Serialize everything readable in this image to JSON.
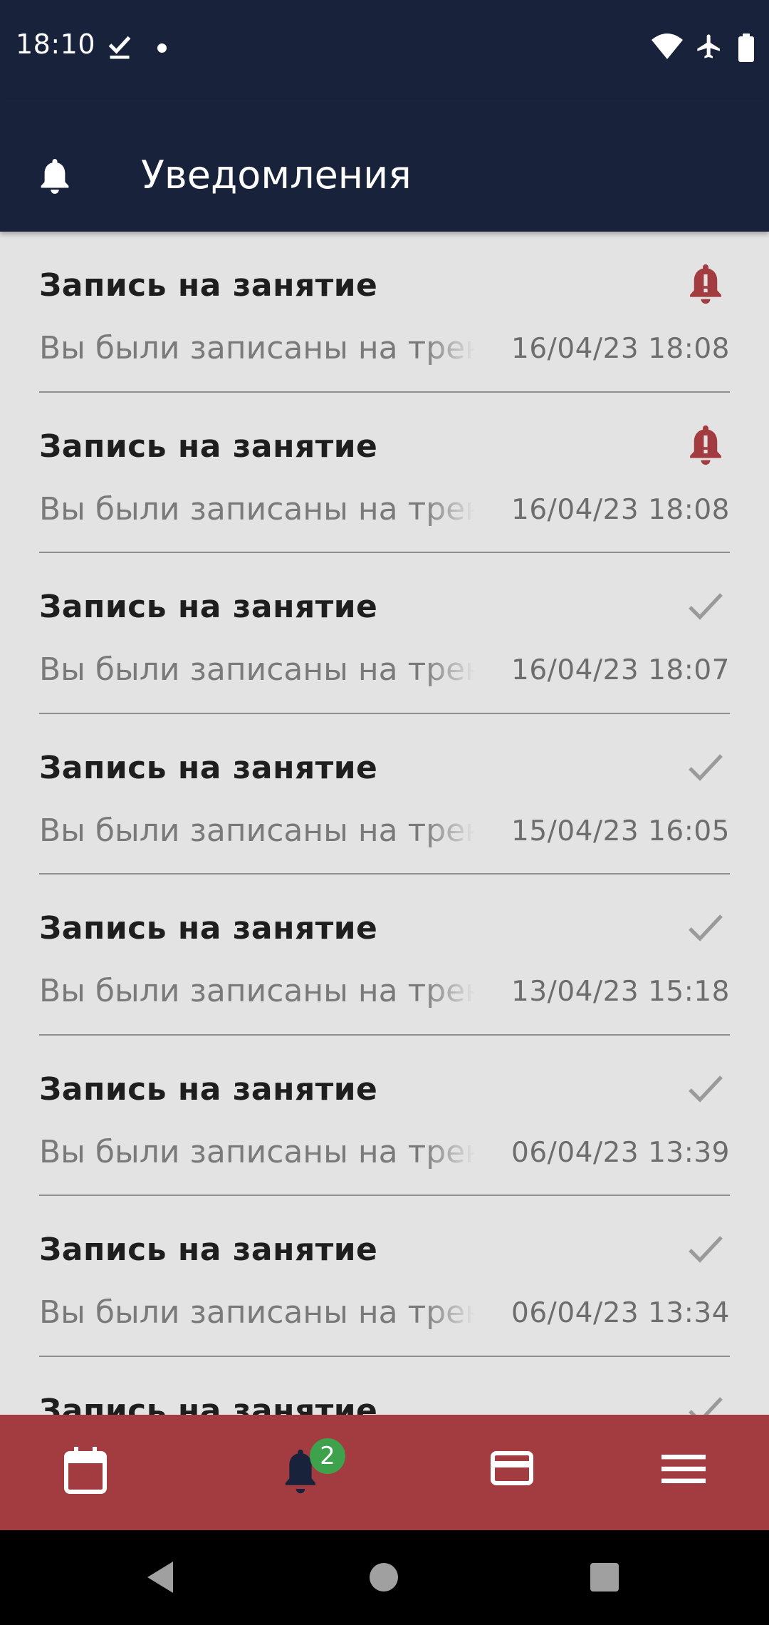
{
  "status_bar": {
    "time": "18:10",
    "icons": [
      "download-done-icon",
      "notification-dot-icon",
      "wifi-icon",
      "airplane-mode-icon",
      "battery-icon"
    ]
  },
  "app_bar": {
    "icon": "bell-icon",
    "title": "Уведомления"
  },
  "notifications": [
    {
      "title": "Запись на занятие",
      "text": "Вы были записаны на тренировку",
      "date": "16/04/23 18:08",
      "status": "unread",
      "icon": "bell-alert-icon"
    },
    {
      "title": "Запись на занятие",
      "text": "Вы были записаны на тренировку",
      "date": "16/04/23 18:08",
      "status": "unread",
      "icon": "bell-alert-icon"
    },
    {
      "title": "Запись на занятие",
      "text": "Вы были записаны на тренировку",
      "date": "16/04/23 18:07",
      "status": "read",
      "icon": "check-icon"
    },
    {
      "title": "Запись на занятие",
      "text": "Вы были записаны на тренировку",
      "date": "15/04/23 16:05",
      "status": "read",
      "icon": "check-icon"
    },
    {
      "title": "Запись на занятие",
      "text": "Вы были записаны на тренировку",
      "date": "13/04/23 15:18",
      "status": "read",
      "icon": "check-icon"
    },
    {
      "title": "Запись на занятие",
      "text": "Вы были записаны на тренировку",
      "date": "06/04/23 13:39",
      "status": "read",
      "icon": "check-icon"
    },
    {
      "title": "Запись на занятие",
      "text": "Вы были записаны на тренировку",
      "date": "06/04/23 13:34",
      "status": "read",
      "icon": "check-icon"
    },
    {
      "title": "Запись на занятие",
      "text": "",
      "date": "",
      "status": "read",
      "icon": "check-icon"
    }
  ],
  "bottom_nav": {
    "items": [
      {
        "name": "calendar",
        "icon": "calendar-icon"
      },
      {
        "name": "notifications",
        "icon": "bell-icon",
        "badge": "2",
        "active": true
      },
      {
        "name": "payments",
        "icon": "credit-card-icon"
      },
      {
        "name": "menu",
        "icon": "menu-icon"
      }
    ]
  },
  "colors": {
    "header_bg": "#18223a",
    "list_bg": "#e3e3e3",
    "accent_red": "#a33c41",
    "badge_green": "#3ea14b",
    "unread_icon": "#a33c41",
    "read_icon": "#9a9a9a"
  },
  "system_nav": [
    "back-icon",
    "home-icon",
    "recents-icon"
  ]
}
